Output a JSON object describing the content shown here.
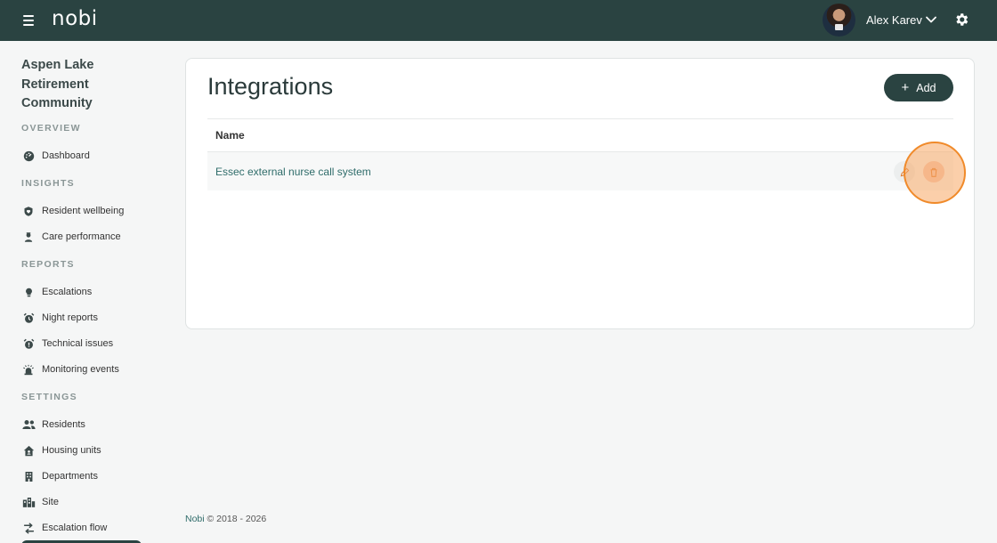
{
  "header": {
    "logo": "nobi",
    "user_name": "Alex Karev"
  },
  "sidebar": {
    "community_name": "Aspen Lake Retirement Community",
    "sections": {
      "overview": "OVERVIEW",
      "insights": "INSIGHTS",
      "reports": "REPORTS",
      "settings": "SETTINGS"
    },
    "items": {
      "dashboard": "Dashboard",
      "resident_wellbeing": "Resident wellbeing",
      "care_performance": "Care performance",
      "escalations": "Escalations",
      "night_reports": "Night reports",
      "technical_issues": "Technical issues",
      "monitoring_events": "Monitoring events",
      "residents": "Residents",
      "housing_units": "Housing units",
      "departments": "Departments",
      "site": "Site",
      "escalation_flow": "Escalation flow"
    }
  },
  "main": {
    "title": "Integrations",
    "add_label": "Add",
    "table": {
      "columns": [
        "Name"
      ],
      "rows": [
        {
          "name": "Essec external nurse call system"
        }
      ]
    }
  },
  "footer": {
    "brand": "Nobi",
    "copyright": "© 2018 - 2026"
  },
  "colors": {
    "topbar": "#2a4341",
    "accent_link": "#2f6c6a",
    "delete_bg": "#f4c9b8",
    "click_highlight": "#f08a2a"
  }
}
